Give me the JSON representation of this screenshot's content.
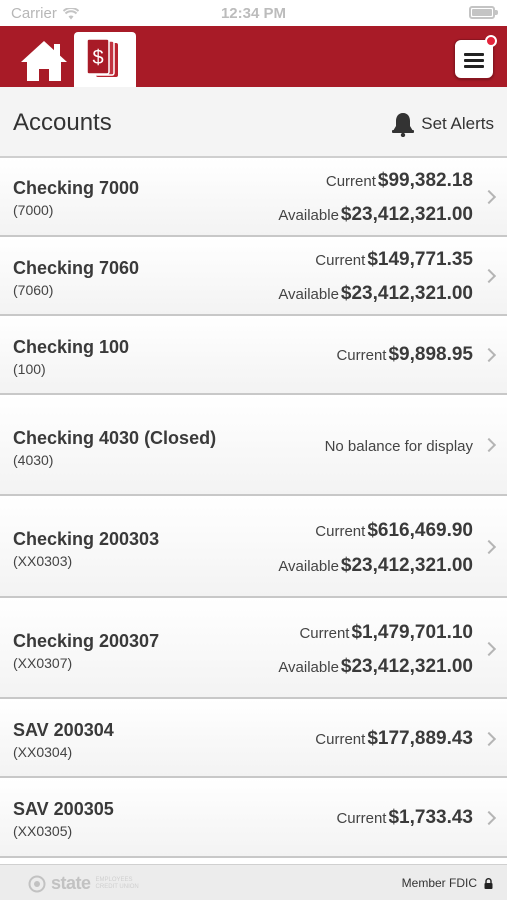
{
  "status_bar": {
    "carrier": "Carrier",
    "time": "12:34 PM",
    "battery_level": 1.0
  },
  "header": {
    "home_icon": "home-icon",
    "accounts_icon": "dollar-bill-icon",
    "menu_icon": "hamburger-menu-icon",
    "brand_color": "#a81b27",
    "badge_color": "#e3243b"
  },
  "title_bar": {
    "title": "Accounts",
    "alerts_label": "Set Alerts",
    "alerts_icon": "bell-icon"
  },
  "accounts": [
    {
      "name": "Checking 7000",
      "number": "(7000)",
      "current_label": "Current",
      "current": "$99,382.18",
      "available_label": "Available",
      "available": "$23,412,321.00"
    },
    {
      "name": "Checking 7060",
      "number": "(7060)",
      "current_label": "Current",
      "current": "$149,771.35",
      "available_label": "Available",
      "available": "$23,412,321.00"
    },
    {
      "name": "Checking 100",
      "number": "(100)",
      "current_label": "Current",
      "current": "$9,898.95"
    },
    {
      "name": "Checking 4030 (Closed)",
      "number": "(4030)",
      "note": "No balance for display"
    },
    {
      "name": "Checking 200303",
      "number": "(XX0303)",
      "current_label": "Current",
      "current": "$616,469.90",
      "available_label": "Available",
      "available": "$23,412,321.00"
    },
    {
      "name": "Checking 200307",
      "number": "(XX0307)",
      "current_label": "Current",
      "current": "$1,479,701.10",
      "available_label": "Available",
      "available": "$23,412,321.00"
    },
    {
      "name": "SAV 200304",
      "number": "(XX0304)",
      "current_label": "Current",
      "current": "$177,889.43"
    },
    {
      "name": "SAV 200305",
      "number": "(XX0305)",
      "current_label": "Current",
      "current": "$1,733.43"
    }
  ],
  "footer": {
    "logo_text": "state",
    "logo_sub_1": "EMPLOYEES",
    "logo_sub_2": "CREDIT UNION",
    "fdic_label": "Member FDIC",
    "lock_icon": "lock-icon"
  }
}
